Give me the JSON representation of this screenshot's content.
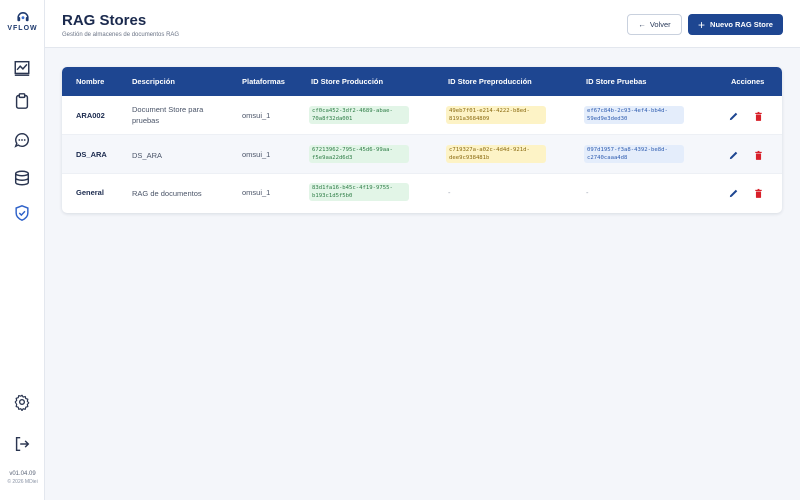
{
  "app": {
    "logo_text": "VFLOW",
    "version": "v01.04.09",
    "copyright": "© 2026 MDiei"
  },
  "header": {
    "title": "RAG Stores",
    "subtitle": "Gestión de almacenes de documentos RAG",
    "back_label": "Volver",
    "new_label": "Nuevo RAG Store"
  },
  "sidebar": {
    "items": [
      {
        "icon": "chart-icon"
      },
      {
        "icon": "clipboard-icon"
      },
      {
        "icon": "chat-icon"
      },
      {
        "icon": "database-icon"
      },
      {
        "icon": "shield-check-icon"
      }
    ],
    "bottom": [
      {
        "icon": "gear-icon"
      },
      {
        "icon": "logout-icon"
      }
    ]
  },
  "table": {
    "columns": [
      "Nombre",
      "Descripción",
      "Plataformas",
      "ID Store Producción",
      "ID Store Preproducción",
      "ID Store Pruebas",
      "Acciones"
    ],
    "rows": [
      {
        "name": "ARA002",
        "description": "Document Store para pruebas",
        "platform": "omsui_1",
        "prod_id": "cf0ca452-3df2-4689-abae-70a8f32da001",
        "preprod_id": "49eb7f01-e214-4222-b8ed-8191a3684809",
        "test_id": "ef67c84b-2c93-4ef4-bb4d-59ed9e3ded30"
      },
      {
        "name": "DS_ARA",
        "description": "DS_ARA",
        "platform": "omsui_1",
        "prod_id": "67213962-795c-45d6-99aa-f5e9aa22d6d3",
        "preprod_id": "c719327a-a02c-4d4d-921d-dee9c938481b",
        "test_id": "097d1957-f3a8-4392-be8d-c2740caaa4d8"
      },
      {
        "name": "General",
        "description": "RAG de documentos",
        "platform": "omsui_1",
        "prod_id": "83d1fa16-b45c-4f19-9755-b193c1d5f5b0",
        "preprod_id": "-",
        "test_id": "-"
      }
    ]
  },
  "colors": {
    "primary": "#1e4691",
    "prod_chip": "#e2f5e7",
    "preprod_chip": "#fdf3c6",
    "test_chip": "#e4edfb",
    "edit_icon": "#1e4691",
    "delete_icon": "#d8202a"
  }
}
